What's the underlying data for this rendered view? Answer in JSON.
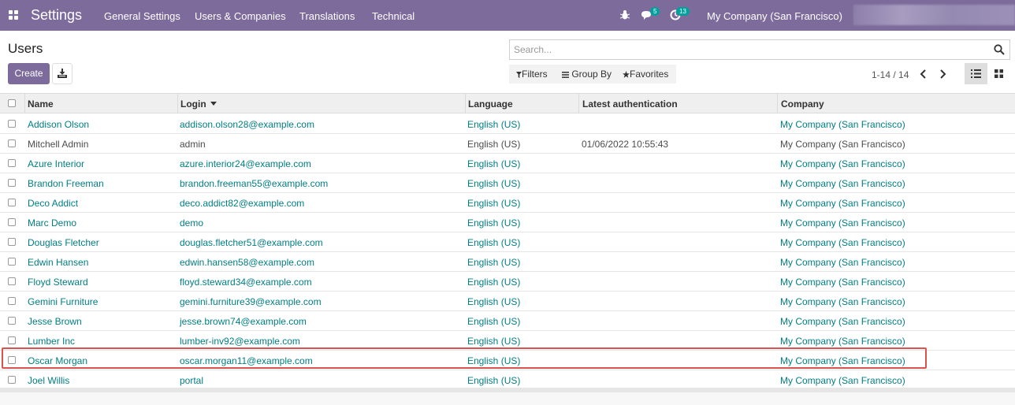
{
  "navbar": {
    "app_title": "Settings",
    "menu": [
      "General Settings",
      "Users & Companies",
      "Translations",
      "Technical"
    ],
    "messages_count": "5",
    "activities_count": "13",
    "company": "My Company (San Francisco)"
  },
  "control_panel": {
    "title": "Users",
    "create_label": "Create",
    "search_placeholder": "Search...",
    "filters_label": "Filters",
    "groupby_label": "Group By",
    "favorites_label": "Favorites",
    "pager": "1-14 / 14"
  },
  "table": {
    "headers": {
      "name": "Name",
      "login": "Login",
      "language": "Language",
      "latest_auth": "Latest authentication",
      "company": "Company"
    },
    "rows": [
      {
        "name": "Addison Olson",
        "login": "addison.olson28@example.com",
        "language": "English (US)",
        "latest_auth": "",
        "company": "My Company (San Francisco)"
      },
      {
        "name": "Mitchell Admin",
        "login": "admin",
        "language": "English (US)",
        "latest_auth": "01/06/2022 10:55:43",
        "company": "My Company (San Francisco)"
      },
      {
        "name": "Azure Interior",
        "login": "azure.interior24@example.com",
        "language": "English (US)",
        "latest_auth": "",
        "company": "My Company (San Francisco)"
      },
      {
        "name": "Brandon Freeman",
        "login": "brandon.freeman55@example.com",
        "language": "English (US)",
        "latest_auth": "",
        "company": "My Company (San Francisco)"
      },
      {
        "name": "Deco Addict",
        "login": "deco.addict82@example.com",
        "language": "English (US)",
        "latest_auth": "",
        "company": "My Company (San Francisco)"
      },
      {
        "name": "Marc Demo",
        "login": "demo",
        "language": "English (US)",
        "latest_auth": "",
        "company": "My Company (San Francisco)"
      },
      {
        "name": "Douglas Fletcher",
        "login": "douglas.fletcher51@example.com",
        "language": "English (US)",
        "latest_auth": "",
        "company": "My Company (San Francisco)"
      },
      {
        "name": "Edwin Hansen",
        "login": "edwin.hansen58@example.com",
        "language": "English (US)",
        "latest_auth": "",
        "company": "My Company (San Francisco)"
      },
      {
        "name": "Floyd Steward",
        "login": "floyd.steward34@example.com",
        "language": "English (US)",
        "latest_auth": "",
        "company": "My Company (San Francisco)"
      },
      {
        "name": "Gemini Furniture",
        "login": "gemini.furniture39@example.com",
        "language": "English (US)",
        "latest_auth": "",
        "company": "My Company (San Francisco)"
      },
      {
        "name": "Jesse Brown",
        "login": "jesse.brown74@example.com",
        "language": "English (US)",
        "latest_auth": "",
        "company": "My Company (San Francisco)"
      },
      {
        "name": "Lumber Inc",
        "login": "lumber-inv92@example.com",
        "language": "English (US)",
        "latest_auth": "",
        "company": "My Company (San Francisco)"
      },
      {
        "name": "Oscar Morgan",
        "login": "oscar.morgan11@example.com",
        "language": "English (US)",
        "latest_auth": "",
        "company": "My Company (San Francisco)"
      },
      {
        "name": "Joel Willis",
        "login": "portal",
        "language": "English (US)",
        "latest_auth": "",
        "company": "My Company (San Francisco)"
      }
    ]
  },
  "colors": {
    "navbar": "#7c6b9b",
    "link": "#017e84",
    "highlight": "#d9534f"
  }
}
